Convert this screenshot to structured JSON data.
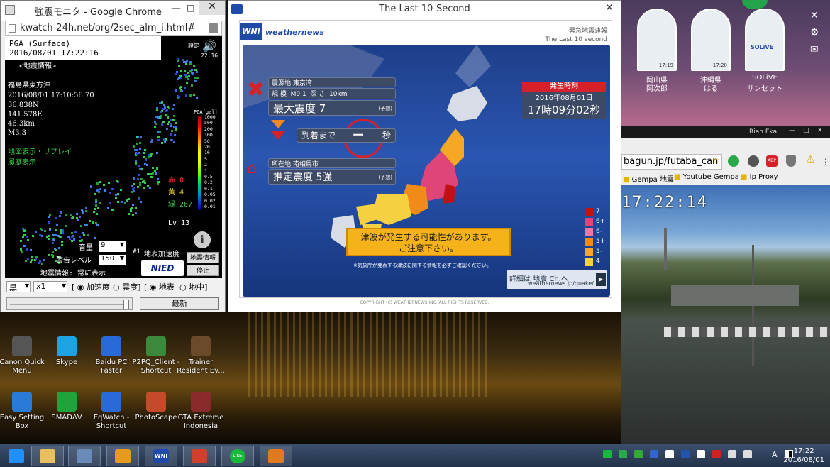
{
  "colors": {
    "taskbar": "#2c3d5a",
    "wni_blue": "#2a56b2",
    "warning_yellow": "#f5b21a",
    "red": "#d6202a"
  },
  "left_window": {
    "title": "強震モニタ - Google Chrome",
    "url": "kwatch-24h.net/org/2sec_alm_i.html#",
    "pga_label": "PGA (Surface)",
    "timestamp": "2016/08/01 17:22:16",
    "settings_label": "設定",
    "time_small": "22:16",
    "eq_info_header": "<地震情報>",
    "eq_location": "福島県東方沖",
    "eq_time": "2016/08/01 17:10:56.70",
    "eq_lat": "36.838N",
    "eq_lon": "141.578E",
    "eq_depth": "46.3km",
    "eq_mag": "M3.3",
    "map_link": "地図表示・リプレイ",
    "history_link": "履歴表示",
    "scale_title": "PGA[gal]",
    "scale_values": [
      "1000",
      "500",
      "200",
      "100",
      "50",
      "20",
      "10",
      "5",
      "2",
      "1",
      "0.5",
      "0.2",
      "0.1",
      "0.05",
      "0.02",
      "0.01"
    ],
    "count_red": "赤 0",
    "count_yellow": "黄 4",
    "count_green": "緑 267",
    "level": "Lv 13",
    "volume_label": "音量",
    "volume_value": "9",
    "warn_label": "警告レベル",
    "warn_value": "150",
    "hash_label": "#1",
    "accel_label": "地表加速度",
    "info_btn": "地震情報",
    "stop_btn": "停止",
    "always_label": "地震情報: 常に表示",
    "nied": "NIED",
    "bg_select": "黒",
    "speed_select": "x1",
    "radio_accel": "加速度",
    "radio_intensity": "震度",
    "radio_surface": "地表",
    "radio_under": "地中",
    "latest_btn": "最新"
  },
  "center_window": {
    "title": "The Last 10-Second",
    "brand": "weathernews",
    "brand_mark": "WNI",
    "header_line1": "緊急地震速報",
    "header_line2": "The Last 10 second",
    "epicenter_label": "震源地",
    "epicenter_value": "東京湾",
    "scale_label": "規 模",
    "mag_value": "M9.1",
    "depth_label": "深 さ",
    "depth_value": "10km",
    "max_int_label": "最大震度",
    "max_int_value": "7",
    "forecast": "(予想)",
    "arrival_label": "到着まで",
    "arrival_value": "ー",
    "arrival_unit": "秒",
    "location_label": "所在地",
    "location_value": "南相馬市",
    "est_label": "推定震度",
    "est_value": "5強",
    "occur_label": "発生時刻",
    "occur_date": "2016年08月01日",
    "occur_time": "17時09分02秒",
    "tsunami_line1": "津波が発生する可能性があります。",
    "tsunami_line2": "ご注意下さい。",
    "note": "※気象庁が発表する津波に関する情報を必ずご確認ください。",
    "legend": [
      {
        "label": "7",
        "color": "#c40f16"
      },
      {
        "label": "6+",
        "color": "#e0457a"
      },
      {
        "label": "6-",
        "color": "#ec78a6"
      },
      {
        "label": "5+",
        "color": "#f08a18"
      },
      {
        "label": "5-",
        "color": "#f5a823"
      },
      {
        "label": "4",
        "color": "#f5d040"
      }
    ],
    "banner_line1": "詳細は 地震 Ch.へ",
    "banner_line2": "weathernews.jp/quake/",
    "copyright": "COPYRIGHT (C) WEATHERNEWS INC. ALL RIGHTS RESERVED."
  },
  "right_top": {
    "thumbs": [
      {
        "time": "17:19",
        "name1": "岡山県",
        "name2": "岡次郎"
      },
      {
        "time": "17:20",
        "name1": "沖縄県",
        "name2": "はる"
      },
      {
        "time": "",
        "name1": "SOLiVE",
        "name2": "サンセット"
      }
    ],
    "user": "Rian Eka",
    "solive_logo": "SOLiVE"
  },
  "right_bottom": {
    "url": "bagun.jp/futaba_can",
    "bookmarks": [
      "Gempa 地震",
      "Youtube Gempa",
      "Ip Proxy"
    ],
    "overlay_time": "17:22:14",
    "abp": "ABP"
  },
  "desktop_icons": [
    {
      "label": "Canon Quick Menu",
      "color": "#555"
    },
    {
      "label": "Skype",
      "color": "#1fa3e0"
    },
    {
      "label": "Baidu PC Faster",
      "color": "#2a6ad8"
    },
    {
      "label": "P2PQ_Client - Shortcut",
      "color": "#3b8a3b"
    },
    {
      "label": "Trainer Resident Ev...",
      "color": "#6a4a2a"
    },
    {
      "label": "Easy Setting Box",
      "color": "#2a7ad8"
    },
    {
      "label": "SMADΔV",
      "color": "#1fa33a"
    },
    {
      "label": "EqWatch - Shortcut",
      "color": "#2a6ad8"
    },
    {
      "label": "PhotoScape",
      "color": "#c44a2a"
    },
    {
      "label": "GTA Extreme Indonesia",
      "color": "#8a2a2a"
    }
  ],
  "taskbar": {
    "tray_ime": "A",
    "clock_time": "17:22",
    "clock_date": "2016/08/01",
    "wni_label": "WNI",
    "line_label": "LINE",
    "items": [
      "start",
      "explorer",
      "app",
      "tool",
      "wni",
      "chrome",
      "line",
      "player"
    ]
  }
}
